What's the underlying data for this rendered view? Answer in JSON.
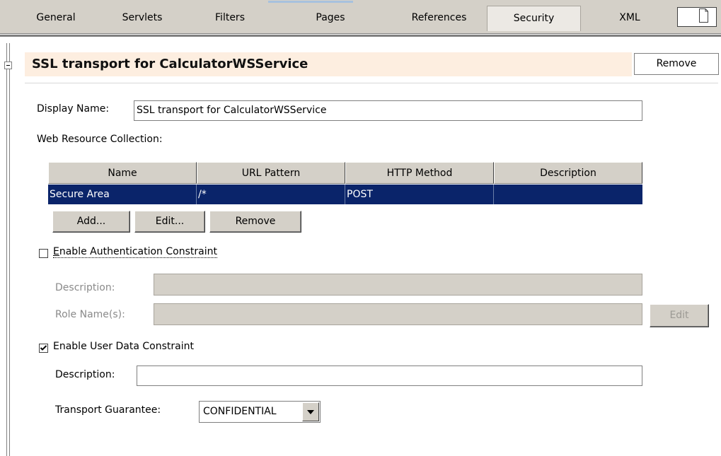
{
  "tabs": [
    {
      "label": "General",
      "active": false
    },
    {
      "label": "Servlets",
      "active": false
    },
    {
      "label": "Filters",
      "active": false
    },
    {
      "label": "Pages",
      "active": false
    },
    {
      "label": "References",
      "active": false
    },
    {
      "label": "Security",
      "active": true
    },
    {
      "label": "XML",
      "active": false
    }
  ],
  "section": {
    "title": "SSL transport for CalculatorWSService",
    "remove_label": "Remove"
  },
  "display_name": {
    "label": "Display Name:",
    "value": "SSL transport for CalculatorWSService"
  },
  "web_resource": {
    "label": "Web Resource Collection:",
    "columns": [
      "Name",
      "URL Pattern",
      "HTTP Method",
      "Description"
    ],
    "rows": [
      {
        "name": "Secure Area",
        "url_pattern": "/*",
        "http_method": "POST",
        "description": ""
      }
    ],
    "add_label": "Add...",
    "edit_label": "Edit...",
    "remove_label": "Remove"
  },
  "auth_constraint": {
    "checked": false,
    "label_first": "E",
    "label_rest": "nable Authentication Constraint",
    "description_label": "Description:",
    "description_value": "",
    "roles_label": "Role Name(s):",
    "roles_value": "",
    "edit_label": "Edit"
  },
  "user_data_constraint": {
    "checked": true,
    "label": "Enable User Data Constraint",
    "description_label": "Description:",
    "description_value": "",
    "transport_label": "Transport Guarantee:",
    "transport_value": "CONFIDENTIAL"
  },
  "colors": {
    "selection": "#0a246a",
    "header_band": "#fdeee0",
    "chrome": "#d4d0c8"
  }
}
